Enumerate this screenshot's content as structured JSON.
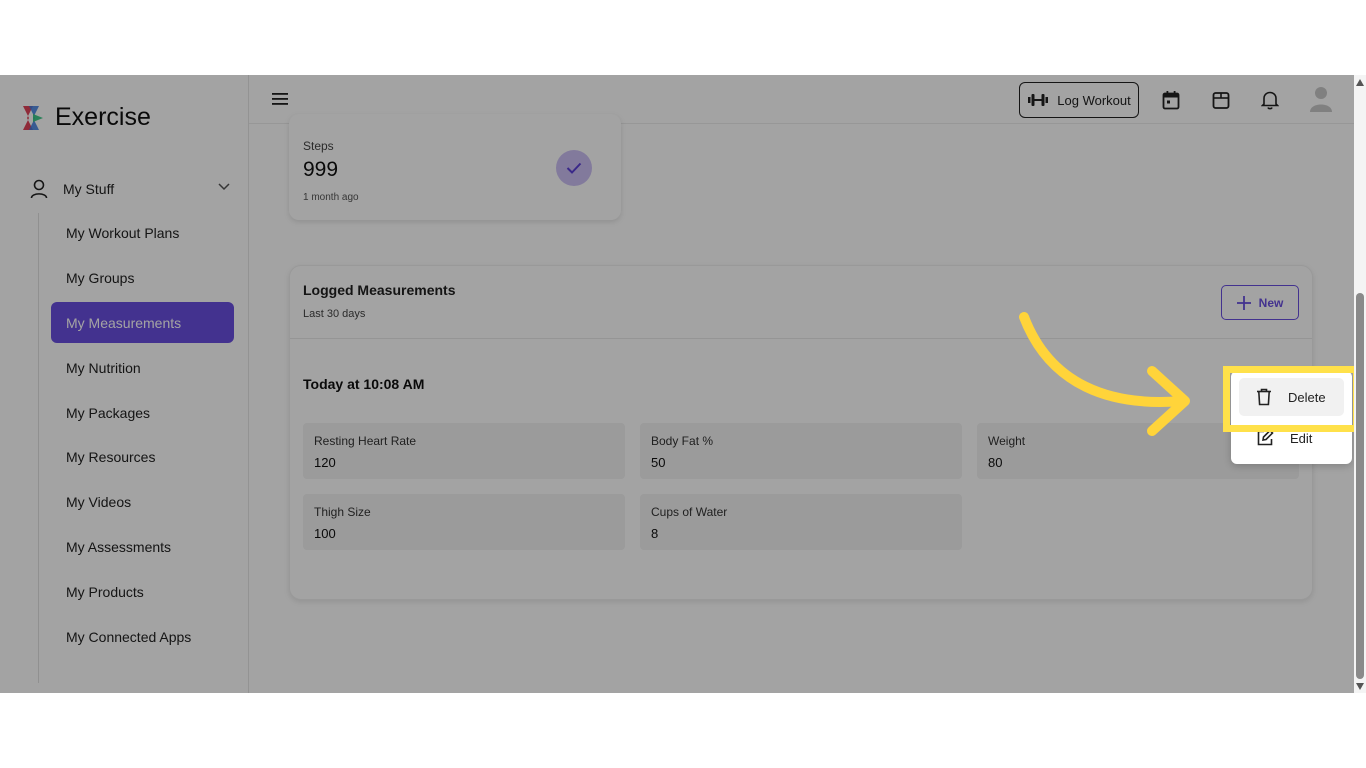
{
  "app": {
    "title": "Exercise"
  },
  "sidebar": {
    "group_label": "My Stuff",
    "items": [
      {
        "label": "My Workout Plans",
        "active": false
      },
      {
        "label": "My Groups",
        "active": false
      },
      {
        "label": "My Measurements",
        "active": true
      },
      {
        "label": "My Nutrition",
        "active": false
      },
      {
        "label": "My Packages",
        "active": false
      },
      {
        "label": "My Resources",
        "active": false
      },
      {
        "label": "My Videos",
        "active": false
      },
      {
        "label": "My Assessments",
        "active": false
      },
      {
        "label": "My Products",
        "active": false
      },
      {
        "label": "My Connected Apps",
        "active": false
      }
    ]
  },
  "topbar": {
    "log_workout_label": "Log Workout",
    "icons": [
      "menu-icon",
      "dumbbell-icon",
      "calendar-icon",
      "package-icon",
      "bell-icon",
      "avatar-icon"
    ]
  },
  "steps_card": {
    "title": "Steps",
    "value": "999",
    "time": "1 month ago"
  },
  "measurements": {
    "title": "Logged Measurements",
    "subtitle": "Last 30 days",
    "new_label": "New",
    "entry": {
      "date": "Today at 10:08 AM",
      "metrics": [
        {
          "label": "Resting Heart Rate",
          "value": "120"
        },
        {
          "label": "Body Fat %",
          "value": "50"
        },
        {
          "label": "Weight",
          "value": "80"
        },
        {
          "label": "Thigh Size",
          "value": "100"
        },
        {
          "label": "Cups of Water",
          "value": "8"
        }
      ]
    }
  },
  "menu": {
    "delete_label": "Delete",
    "edit_label": "Edit"
  },
  "colors": {
    "accent": "#6a4fe0",
    "highlight": "#ffe14a",
    "overlay": "rgba(0,0,0,0.36)"
  }
}
